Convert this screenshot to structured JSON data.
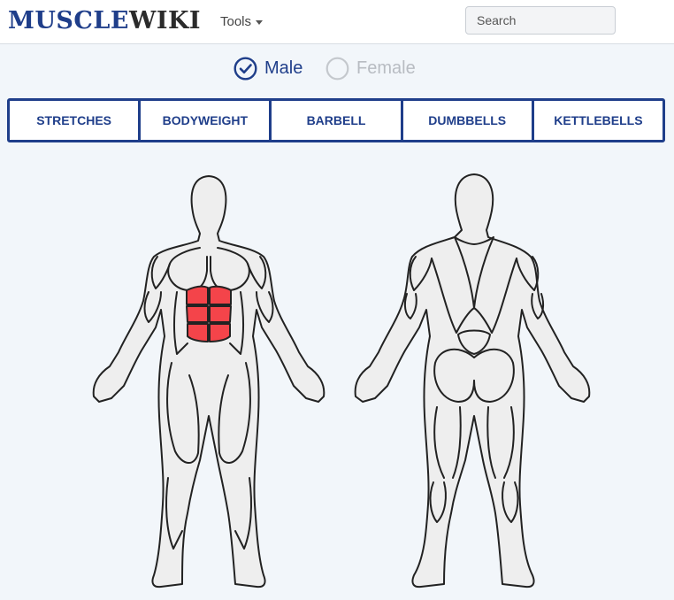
{
  "brand": {
    "part1": "MUSCLE",
    "part2": "WIKI"
  },
  "nav": {
    "tools_label": "Tools"
  },
  "search": {
    "placeholder": "Search"
  },
  "gender": {
    "male": {
      "label": "Male",
      "selected": true
    },
    "female": {
      "label": "Female",
      "selected": false
    }
  },
  "tabs": [
    {
      "label": "STRETCHES"
    },
    {
      "label": "BODYWEIGHT"
    },
    {
      "label": "BARBELL"
    },
    {
      "label": "DUMBBELLS"
    },
    {
      "label": "KETTLEBELLS"
    }
  ],
  "colors": {
    "brand": "#1f3e8a",
    "selected_muscle": "#f4444a",
    "muscle_fill": "#eeeeee",
    "outline": "#222222"
  },
  "diagram": {
    "views": [
      "front",
      "back"
    ],
    "selected_muscle": "abdominals"
  }
}
